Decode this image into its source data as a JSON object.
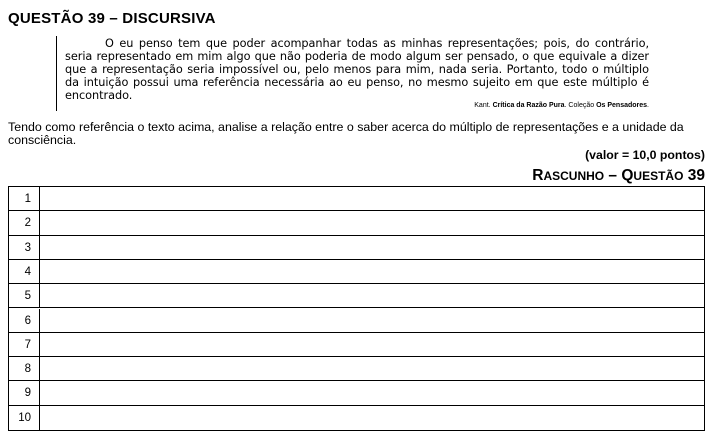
{
  "header": {
    "title": "QUESTÃO 39 – DISCURSIVA"
  },
  "quote": {
    "text": "O eu penso tem que poder acompanhar todas as minhas representações; pois, do contrário, seria representado em mim algo que não poderia de modo algum ser pensado, o que equivale a dizer que a representação seria impossível ou, pelo menos para mim, nada seria. Portanto, todo o múltiplo da intuição possui uma referência necessária ao eu penso, no mesmo sujeito em que este múltiplo é encontrado.",
    "citation": {
      "author": "Kant.",
      "work": "Crítica da Razão Pura",
      "separator": ". Coleção",
      "collection": "Os Pensadores",
      "end": "."
    }
  },
  "question": {
    "prompt": "Tendo como referência o texto acima, analise a relação entre o saber acerca do múltiplo de representações e a unidade da consciência.",
    "value": "(valor = 10,0 pontos)"
  },
  "rascunho": {
    "r_initial": "R",
    "r_rest": "ASCUNHO",
    "dash": " – ",
    "q_initial": "Q",
    "q_rest": "UESTÃO",
    "number": " 39"
  },
  "answer_lines": [
    "1",
    "2",
    "3",
    "4",
    "5",
    "6",
    "7",
    "8",
    "9",
    "10"
  ]
}
